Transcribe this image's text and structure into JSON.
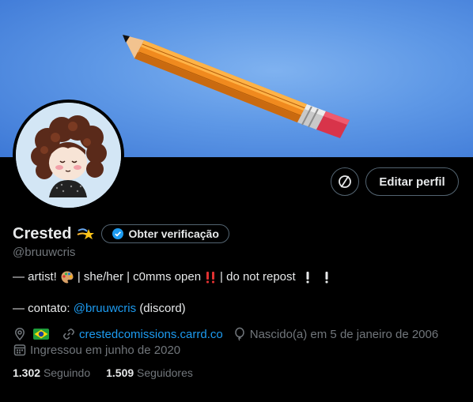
{
  "colors": {
    "background": "#000000",
    "text_primary": "#e7e9ea",
    "text_secondary": "#71767b",
    "link": "#1d9bf0",
    "border": "#536471",
    "banner_blue": "#5e98e6"
  },
  "banner": {
    "icon": "pencil-illustration"
  },
  "avatar": {
    "icon": "avatar-illustration"
  },
  "actions": {
    "icon_button": "no-signal-icon",
    "edit_label": "Editar perfil"
  },
  "profile": {
    "name": "Crested",
    "name_emoji": "shooting-star-icon",
    "verify_label": "Obter verificação",
    "handle": "@bruuwcris"
  },
  "bio": {
    "line1_prefix": "— artist!",
    "line1_mid": "| she/her | c0mms open",
    "line1_suffix": "| do not repost",
    "line2_prefix": "— contato:",
    "line2_mention": "@bruuwcris",
    "line2_suffix": "(discord)"
  },
  "meta": {
    "website": "crestedcomissions.carrd.co",
    "birth": "Nascido(a) em 5 de janeiro de 2006",
    "joined": "Ingressou em junho de 2020"
  },
  "follow": {
    "following_count": "1.302",
    "following_label": "Seguindo",
    "followers_count": "1.509",
    "followers_label": "Seguidores"
  }
}
